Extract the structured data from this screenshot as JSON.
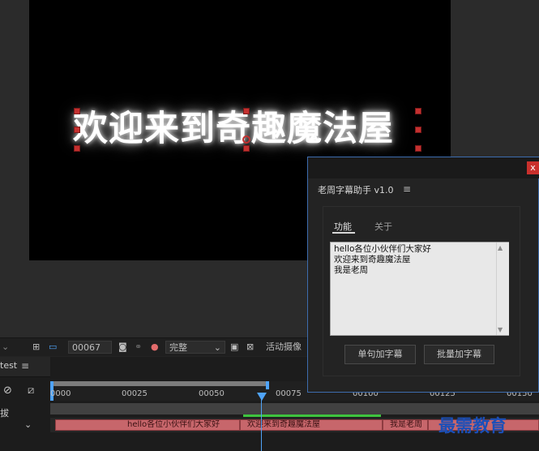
{
  "composition": {
    "title_text": "欢迎来到奇趣魔法屋"
  },
  "viewer_toolbar": {
    "frame_field": "00067",
    "resolution": "完整",
    "camera_label": "活动摄像"
  },
  "timeline": {
    "comp_name": "test",
    "ticks": [
      "0000",
      "00025",
      "00050",
      "00075",
      "00100",
      "00125",
      "00150"
    ],
    "layer_label": "拔",
    "clips": [
      "hello各位小伙伴们大家好",
      "欢迎来到奇趣魔法屋",
      "我是老周"
    ]
  },
  "panel": {
    "title": "老周字幕助手 v1.0",
    "close": "x",
    "tabs": [
      "功能",
      "关于"
    ],
    "textarea_value": "hello各位小伙伴们大家好\n欢迎来到奇趣魔法屋\n我是老周",
    "buttons": {
      "single": "单句加字幕",
      "batch": "批量加字幕"
    }
  },
  "watermark": "最需教育",
  "icons": {
    "menu": "hamburger-icon",
    "camera": "camera-icon",
    "color": "color-channels-icon"
  }
}
